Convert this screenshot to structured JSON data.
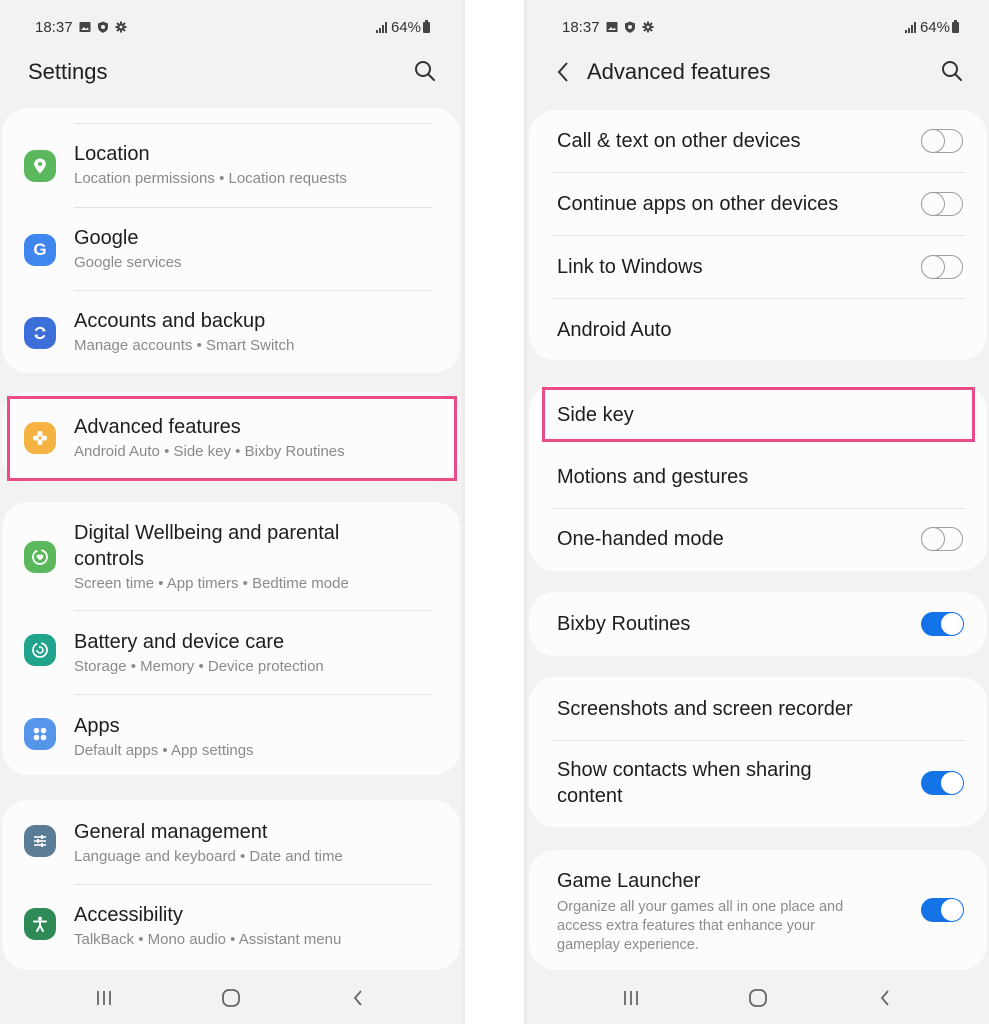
{
  "left": {
    "status": {
      "time": "18:37",
      "battery": "64%",
      "icons": [
        "gallery-icon",
        "shield-icon",
        "gear-icon"
      ]
    },
    "title": "Settings",
    "groups": [
      {
        "items": [
          {
            "id": "location",
            "title": "Location",
            "subtitle": "Location permissions  •  Location requests",
            "icon": "location-pin-icon",
            "color": "#5cb85c"
          },
          {
            "id": "google",
            "title": "Google",
            "subtitle": "Google services",
            "icon": "google-g-icon",
            "color": "#3f86ef"
          },
          {
            "id": "accounts",
            "title": "Accounts and backup",
            "subtitle": "Manage accounts  •  Smart Switch",
            "icon": "sync-icon",
            "color": "#3c6fd8"
          }
        ]
      },
      {
        "items": [
          {
            "id": "advanced",
            "title": "Advanced features",
            "subtitle": "Android Auto  •  Side key  •  Bixby Routines",
            "icon": "advanced-gear-plus-icon",
            "color": "#f7b342",
            "highlighted": true
          }
        ]
      },
      {
        "items": [
          {
            "id": "wellbeing",
            "title": "Digital Wellbeing and parental controls",
            "title_line1": "Digital Wellbeing and parental",
            "title_line2": "controls",
            "subtitle": "Screen time  •  App timers  •  Bedtime mode",
            "icon": "wellbeing-heart-icon",
            "color": "#5cb85c"
          },
          {
            "id": "battery",
            "title": "Battery and device care",
            "subtitle": "Storage  •  Memory  •  Device protection",
            "icon": "device-care-icon",
            "color": "#1fa38a"
          },
          {
            "id": "apps",
            "title": "Apps",
            "subtitle": "Default apps  •  App settings",
            "icon": "apps-grid-icon",
            "color": "#5595ea"
          }
        ]
      },
      {
        "items": [
          {
            "id": "general",
            "title": "General management",
            "subtitle": "Language and keyboard  •  Date and time",
            "icon": "sliders-icon",
            "color": "#5a7c97"
          },
          {
            "id": "accessibility",
            "title": "Accessibility",
            "subtitle": "TalkBack  •  Mono audio  •  Assistant menu",
            "icon": "accessibility-person-icon",
            "color": "#2e8b57"
          }
        ]
      }
    ]
  },
  "right": {
    "status": {
      "time": "18:37",
      "battery": "64%",
      "icons": [
        "gallery-icon",
        "shield-icon",
        "gear-icon"
      ]
    },
    "title": "Advanced features",
    "items": {
      "call_text": {
        "title": "Call & text on other devices",
        "toggle": false
      },
      "continue_apps": {
        "title": "Continue apps on other devices",
        "toggle": false
      },
      "link_windows": {
        "title": "Link to Windows",
        "toggle": false
      },
      "android_auto": {
        "title": "Android Auto"
      },
      "side_key": {
        "title": "Side key",
        "highlighted": true
      },
      "motions": {
        "title": "Motions and gestures"
      },
      "one_handed": {
        "title": "One-handed mode",
        "toggle": false
      },
      "bixby": {
        "title": "Bixby Routines",
        "toggle": true
      },
      "screenshots": {
        "title": "Screenshots and screen recorder"
      },
      "show_contacts": {
        "title": "Show contacts when sharing content",
        "title_line1": "Show contacts when sharing",
        "title_line2": "content",
        "toggle": true
      },
      "game_launcher": {
        "title": "Game Launcher",
        "subtitle_line1": "Organize all your games all in one place and",
        "subtitle_line2": "access extra features that enhance your",
        "subtitle_line3": "gameplay experience.",
        "toggle": true
      }
    }
  },
  "navbar": {
    "buttons": [
      "recent-apps-icon",
      "home-icon",
      "back-icon"
    ]
  },
  "colors": {
    "highlight": "#ea4c89",
    "toggle_on": "#1473e6",
    "background": "#f2f2f2",
    "card": "#fcfcfc"
  }
}
